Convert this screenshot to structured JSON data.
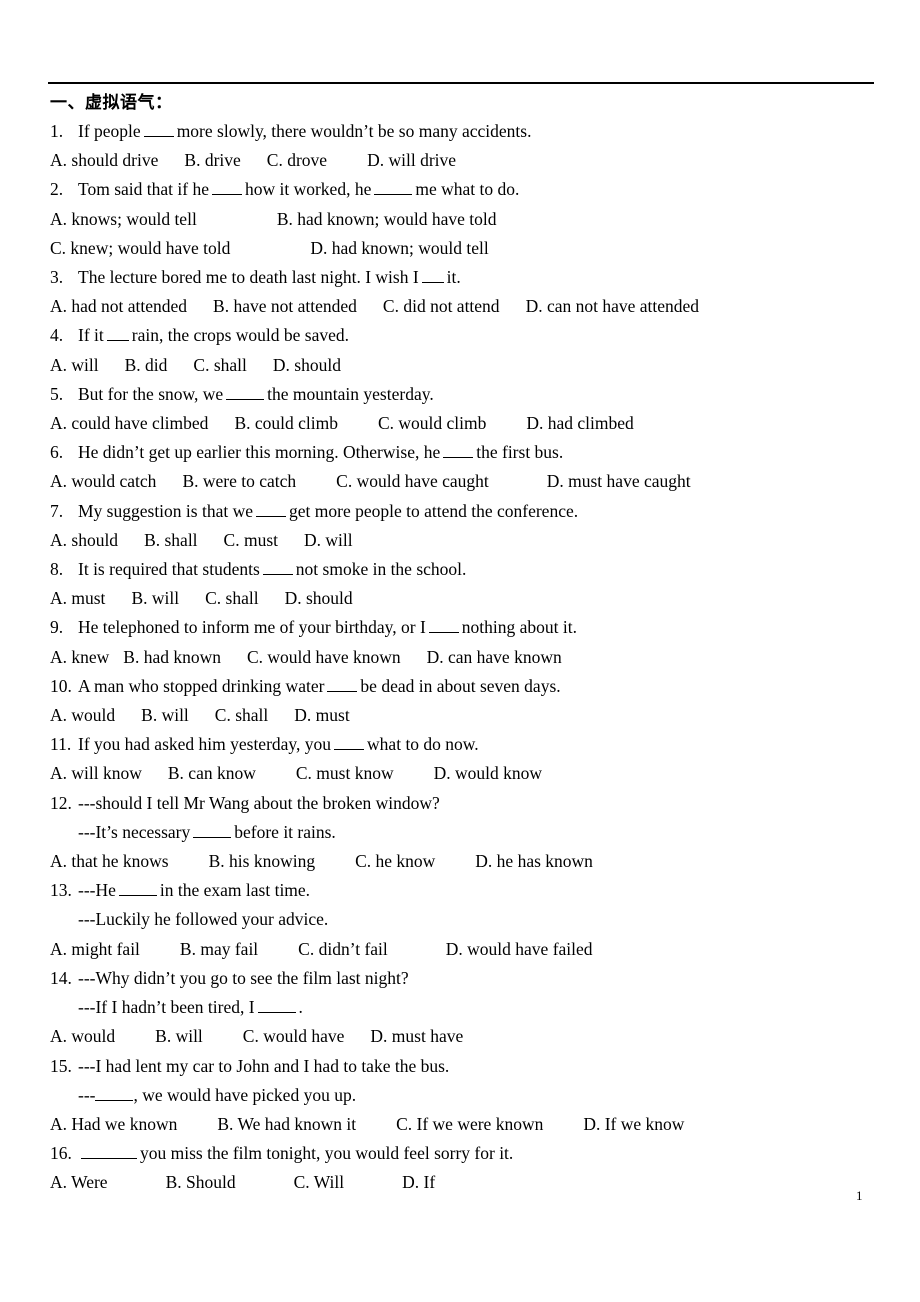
{
  "document": {
    "section_heading": "一、虚拟语气：",
    "page_number": "1"
  },
  "questions": [
    {
      "number": "1.",
      "stem_before": "If people",
      "blank": "b4",
      "stem_after": "more slowly, there wouldn’t be so many accidents.",
      "options": [
        "A.  should drive",
        "B. drive",
        "C. drove",
        "D. will drive"
      ]
    },
    {
      "number": "2.",
      "stem_before": "Tom said that if he",
      "blank": "b4",
      "stem_mid": "how it worked, he",
      "blank2": "b5",
      "stem_after": "me what to do.",
      "options": [
        "A.  knows; would tell",
        "B. had known; would have told",
        "C. knew; would have told",
        "D. had known; would tell"
      ]
    },
    {
      "number": "3.",
      "stem_before": "The lecture bored me to death last night. I wish I",
      "blank": "b3",
      "stem_after": "it.",
      "options": [
        "A.  had not attended",
        "B. have not attended",
        "C. did not attend",
        "D. can not have attended"
      ]
    },
    {
      "number": "4.",
      "stem_before": "If it",
      "blank": "b3",
      "stem_after": "rain, the crops would be saved.",
      "options": [
        "A.  will",
        "B. did",
        "C. shall",
        "D. should"
      ]
    },
    {
      "number": "5.",
      "stem_before": "But for the snow, we",
      "blank": "b5",
      "stem_after": "the mountain yesterday.",
      "options": [
        "A.  could have climbed",
        "B. could climb",
        "C. would climb",
        "D. had climbed"
      ]
    },
    {
      "number": "6.",
      "stem_before": "He didn’t get up earlier this morning. Otherwise, he",
      "blank": "b4",
      "stem_after": "the first bus.",
      "options": [
        "A.  would catch",
        "B. were to catch",
        "C. would have caught",
        "D. must have caught"
      ]
    },
    {
      "number": "7.",
      "stem_before": "My suggestion is that we",
      "blank": "b4",
      "stem_after": "get more people to attend the conference.",
      "options": [
        "A.  should",
        "B. shall",
        "C. must",
        "D. will"
      ]
    },
    {
      "number": "8.",
      "stem_before": "It is required that students",
      "blank": "b4",
      "stem_after": "not smoke in the school.",
      "options": [
        "A.  must",
        "B. will",
        "C. shall",
        "D. should"
      ]
    },
    {
      "number": "9.",
      "stem_before": "He telephoned to inform me of your birthday, or I",
      "blank": "b4",
      "stem_after": "nothing about it.",
      "options": [
        "A.  knew",
        "B. had known",
        "C. would have known",
        "D. can have known"
      ]
    },
    {
      "number": "10.",
      "stem_before": "A man who stopped drinking water",
      "blank": "b4",
      "stem_after": "be dead in about seven days.",
      "options": [
        "A.  would",
        "B. will",
        "C. shall",
        "D. must"
      ]
    },
    {
      "number": "11.",
      "stem_before": "If you had asked him yesterday, you",
      "blank": "b4",
      "stem_after": "what to do now.",
      "options": [
        "A.  will know",
        "B. can know",
        "C. must know",
        "D. would know"
      ]
    },
    {
      "number": "12.",
      "stem_before": "---should I tell Mr Wang about the broken window?",
      "continuation_before": "---It’s necessary",
      "blank": "b5",
      "continuation_after": "before it rains.",
      "options": [
        "A.  that he knows",
        "B. his knowing",
        "C. he know",
        "D. he has known"
      ]
    },
    {
      "number": "13.",
      "stem_before": "---He",
      "blank": "b5",
      "stem_after": "in the exam last time.",
      "continuation": "---Luckily he followed your advice.",
      "options": [
        "A.  might fail",
        "B. may fail",
        "C. didn’t fail",
        "D. would have failed"
      ]
    },
    {
      "number": "14.",
      "stem_before": "---Why didn’t you go to see the film last night?",
      "continuation_before": "---If I hadn’t been tired, I",
      "blank": "b5",
      "continuation_after": ".",
      "options": [
        "A.  would",
        "B. will",
        "C. would have",
        "D. must have"
      ]
    },
    {
      "number": "15.",
      "stem_before": "---I had lent my car to John and I had to take the bus.",
      "continuation_before": "---",
      "blank": "b5",
      "continuation_after": ", we would have picked you up.",
      "options": [
        "A.  Had we known",
        "B. We had known it",
        "C. If we were known",
        "D. If we know"
      ]
    },
    {
      "number": "16.",
      "stem_before": "",
      "blank": "b7",
      "stem_after": "you miss the film tonight, you would feel sorry for it.",
      "options": [
        "A.  Were",
        "B. Should",
        "C. Will",
        "D. If"
      ]
    }
  ]
}
